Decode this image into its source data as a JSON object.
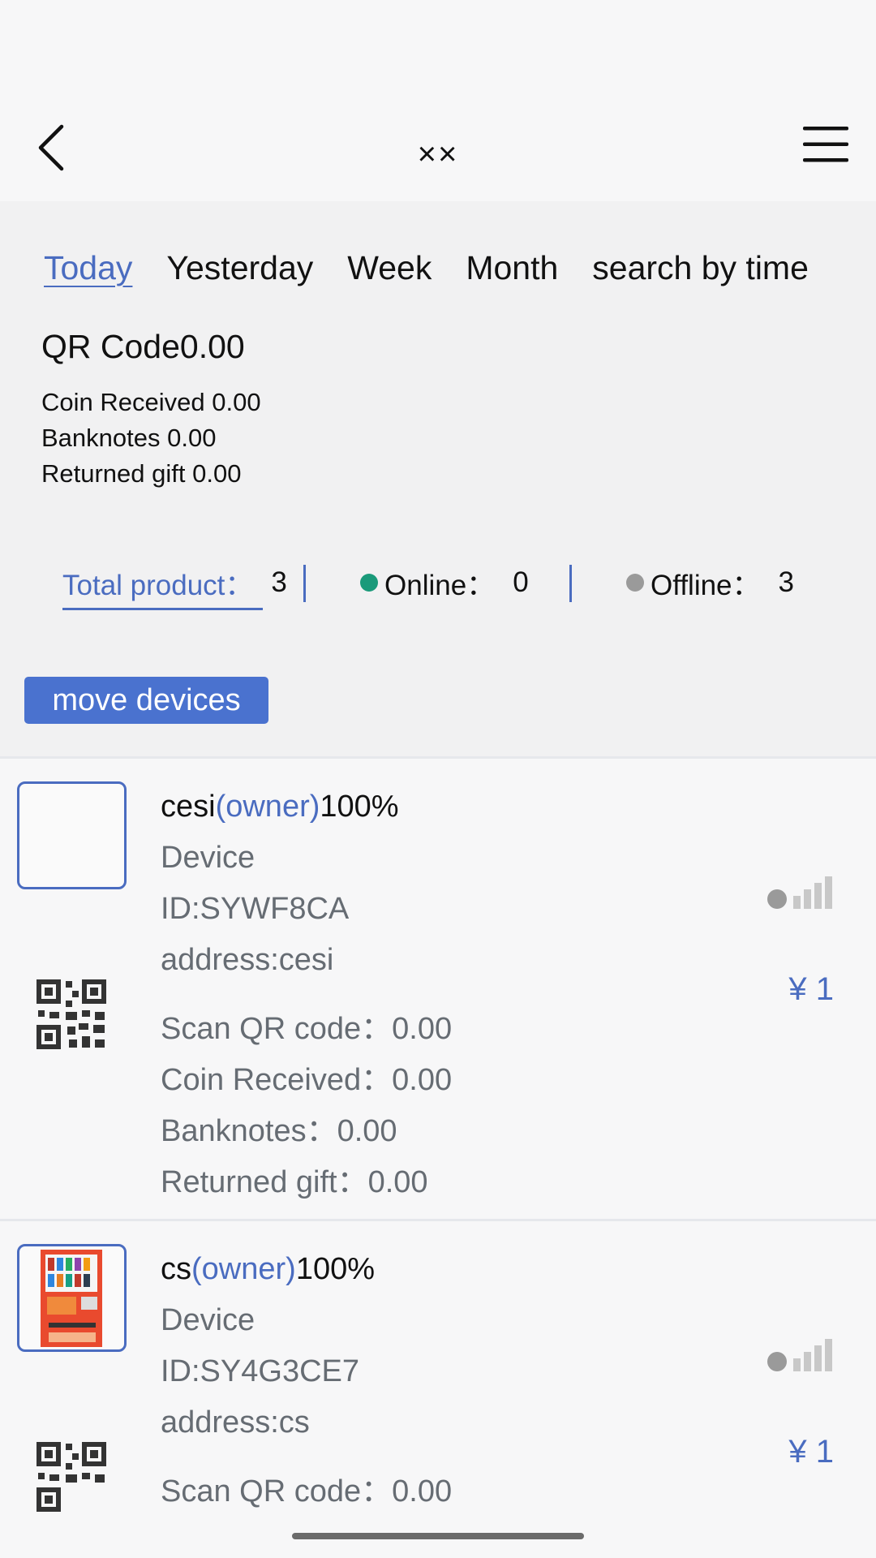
{
  "header": {
    "title": "××"
  },
  "tabs": [
    {
      "label": "Today",
      "active": true
    },
    {
      "label": "Yesterday",
      "active": false
    },
    {
      "label": "Week",
      "active": false
    },
    {
      "label": "Month",
      "active": false
    },
    {
      "label": "search by time",
      "active": false
    }
  ],
  "summary": {
    "qr_label": "QR Code",
    "qr_value": "0.00",
    "coin": "Coin Received 0.00",
    "banknotes": "Banknotes 0.00",
    "returned": "Returned gift 0.00"
  },
  "stats": {
    "total_label": "Total product：",
    "total_value": "3",
    "online_label": "Online：",
    "online_value": "0",
    "offline_label": "Offline：",
    "offline_value": "3",
    "online_color": "#1a9a7a",
    "offline_color": "#9a9a9a"
  },
  "move_button": "move devices",
  "devices": [
    {
      "name": "cesi",
      "owner": "(owner)",
      "percent": "100%",
      "type": "Device",
      "id": "ID:SYWF8CA",
      "address": "address:cesi",
      "scan_qr": "Scan QR code：0.00",
      "coin": "Coin Received：0.00",
      "banknotes": "Banknotes：0.00",
      "returned": "Returned gift：0.00",
      "price": "¥ 1",
      "thumb": "empty-thumbnail"
    },
    {
      "name": "cs",
      "owner": "(owner)",
      "percent": "100%",
      "type": "Device",
      "id": "ID:SY4G3CE7",
      "address": "address:cs",
      "scan_qr": "Scan QR code：0.00",
      "price": "¥ 1",
      "thumb": "vending-machine-image"
    }
  ],
  "colors": {
    "accent": "#4a6cc0",
    "button": "#4a72cf",
    "muted_text": "#666c73"
  }
}
